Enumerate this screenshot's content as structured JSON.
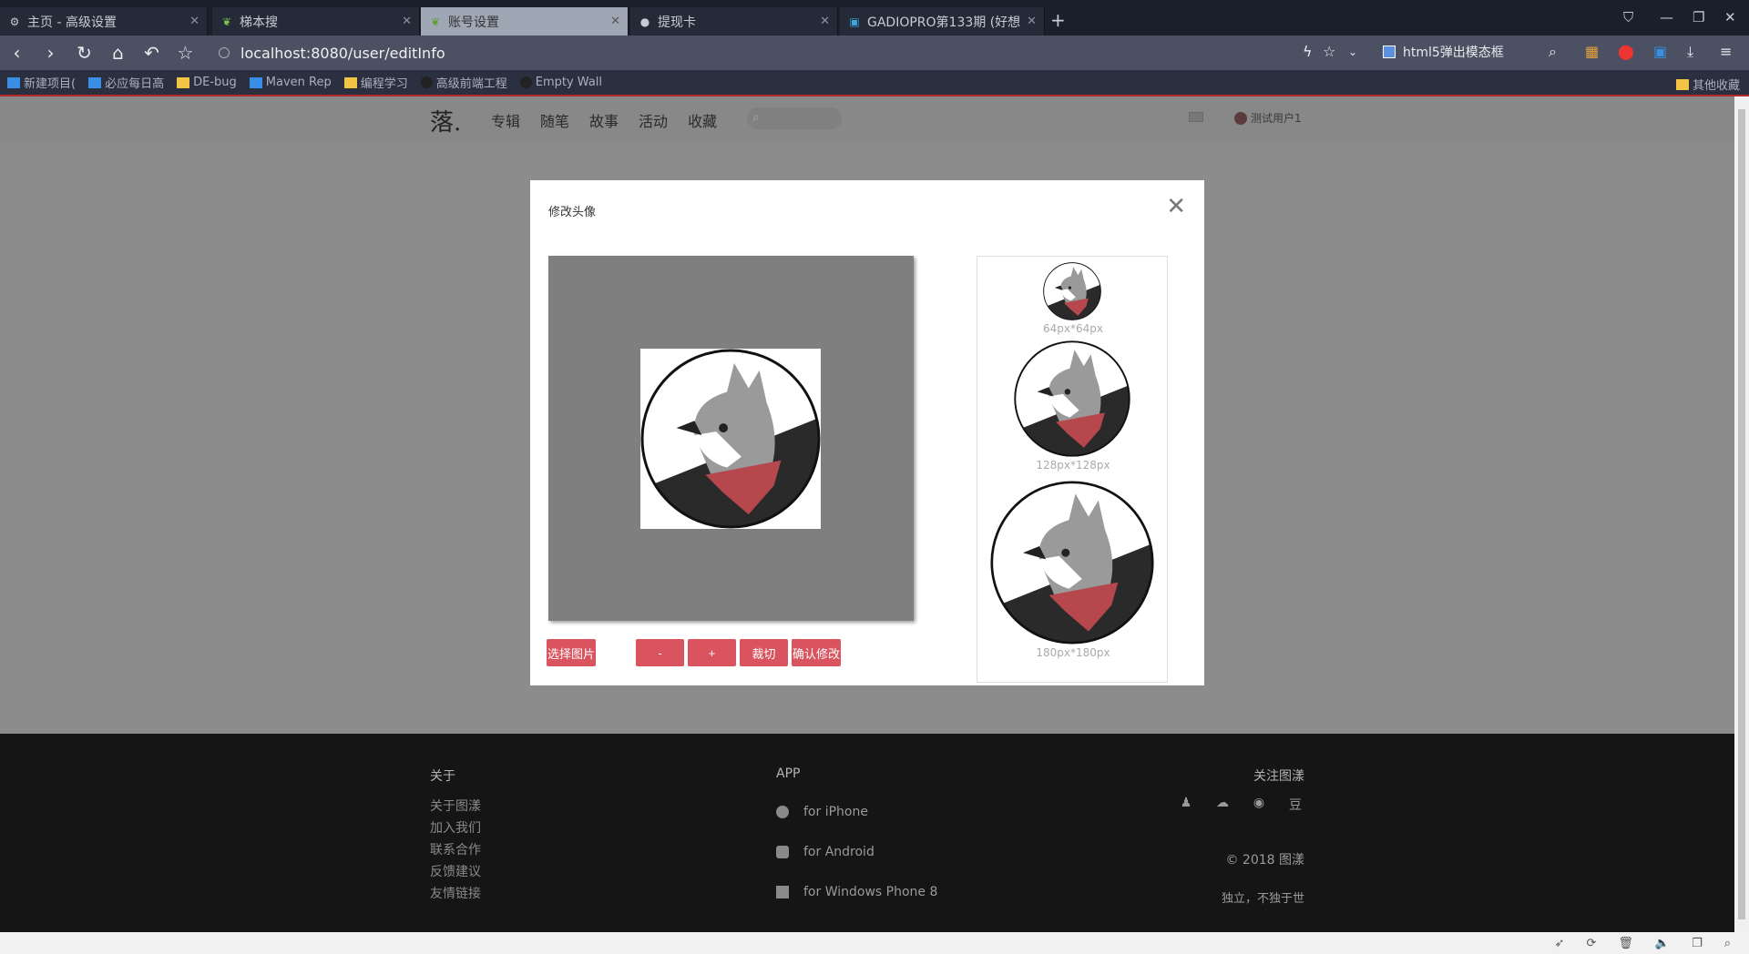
{
  "browser": {
    "tabs": [
      {
        "label": "主页 - 高级设置",
        "active": false
      },
      {
        "label": "梯本搜",
        "active": false
      },
      {
        "label": "账号设置",
        "active": true
      },
      {
        "label": "提现卡",
        "active": false
      },
      {
        "label": "GADIOPRO第133期 (好想活",
        "active": false
      }
    ],
    "url": "localhost:8080/user/editInfo",
    "search_hint": "html5弹出模态框",
    "bookmarks": [
      "新建项目(",
      "必应每日高",
      "DE-bug",
      "Maven Rep",
      "编程学习",
      "高级前端工程",
      "Empty Wall"
    ],
    "bookmarks_other": "其他收藏",
    "accent": "#b22a2a"
  },
  "site": {
    "logo": "落.",
    "nav": [
      "专辑",
      "随笔",
      "故事",
      "活动",
      "收藏"
    ],
    "username": "测试用户1"
  },
  "modal": {
    "title": "修改头像",
    "close": "✕",
    "buttons": {
      "select": "选择图片",
      "zoom_out": "-",
      "zoom_in": "+",
      "crop": "裁切",
      "confirm": "确认修改"
    },
    "previews": [
      "64px*64px",
      "128px*128px",
      "180px*180px"
    ],
    "button_color": "#d9545f"
  },
  "footer": {
    "about_head": "关于",
    "about_links": [
      "关于图漾",
      "加入我们",
      "联系合作",
      "反馈建议",
      "友情链接"
    ],
    "app_head": "APP",
    "apps": [
      "for iPhone",
      "for Android",
      "for Windows Phone 8"
    ],
    "follow_head": "关注图漾",
    "social_icons": [
      "qq-icon",
      "wechat-icon",
      "weibo-icon",
      "douban-icon"
    ],
    "douban_glyph": "豆",
    "copyright": "© 2018 图漾",
    "motto": "独立，不独于世"
  }
}
